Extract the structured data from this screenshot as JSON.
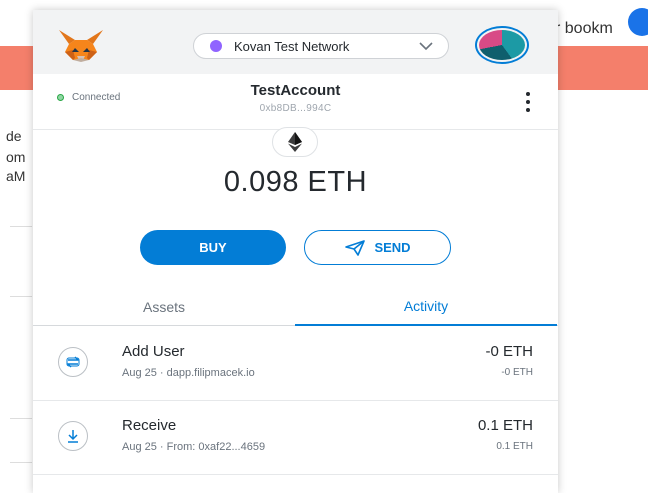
{
  "browser": {
    "bookmark_text": "r bookm",
    "left_fragments": [
      "de",
      "om",
      "aM"
    ]
  },
  "header": {
    "network_label": "Kovan Test Network",
    "network_color": "#9064ff"
  },
  "account": {
    "status": "Connected",
    "name": "TestAccount",
    "address": "0xb8DB...994C"
  },
  "balance": {
    "text": "0.098 ETH"
  },
  "actions": {
    "buy_label": "BUY",
    "send_label": "SEND"
  },
  "tabs": {
    "assets": "Assets",
    "activity": "Activity",
    "active": "activity"
  },
  "transactions": [
    {
      "title": "Add User",
      "subtitle": "Aug 25 · dapp.filipmacek.io",
      "amount": "-0 ETH",
      "fiat": "-0 ETH",
      "icon": "interaction-icon"
    },
    {
      "title": "Receive",
      "subtitle": "Aug 25 · From: 0xaf22...4659",
      "amount": "0.1 ETH",
      "fiat": "0.1 ETH",
      "icon": "receive-icon"
    }
  ],
  "colors": {
    "accent": "#037dd6",
    "page_banner": "#f47f6b",
    "connected": "#28a745"
  }
}
